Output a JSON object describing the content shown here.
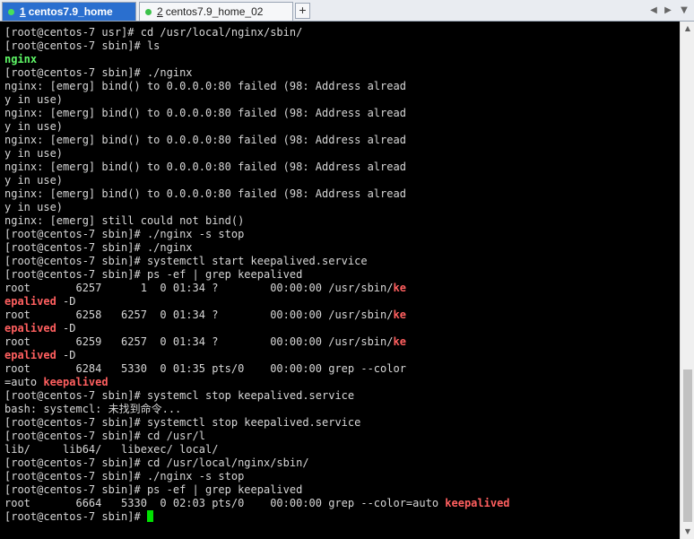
{
  "tabs": [
    {
      "number": "1",
      "label": " centos7.9_home"
    },
    {
      "number": "2",
      "label": " centos7.9_home_02"
    }
  ],
  "icons": {
    "tab_status": "green-dot-icon",
    "add_tab": "plus-icon",
    "add_tab_glyph": "+",
    "nav_left": "◀",
    "nav_right": "▶",
    "nav_menu": "▼",
    "scroll_up": "▲",
    "scroll_down": "▼"
  },
  "colors": {
    "background": "#000000",
    "text": "#d7d7d7",
    "executable": "#5ff967",
    "grep_match": "#ff5f5f",
    "cursor": "#00e000",
    "active_tab": "#2a6fcf"
  },
  "terminal": {
    "lines": [
      [
        {
          "t": "[root@centos-7 usr]# cd /usr/local/nginx/sbin/"
        }
      ],
      [
        {
          "t": "[root@centos-7 sbin]# ls"
        }
      ],
      [
        {
          "t": "nginx",
          "c": "green"
        }
      ],
      [
        {
          "t": "[root@centos-7 sbin]# ./nginx"
        }
      ],
      [
        {
          "t": "nginx: [emerg] bind() to 0.0.0.0:80 failed (98: Address alread"
        }
      ],
      [
        {
          "t": "y in use)"
        }
      ],
      [
        {
          "t": "nginx: [emerg] bind() to 0.0.0.0:80 failed (98: Address alread"
        }
      ],
      [
        {
          "t": "y in use)"
        }
      ],
      [
        {
          "t": "nginx: [emerg] bind() to 0.0.0.0:80 failed (98: Address alread"
        }
      ],
      [
        {
          "t": "y in use)"
        }
      ],
      [
        {
          "t": "nginx: [emerg] bind() to 0.0.0.0:80 failed (98: Address alread"
        }
      ],
      [
        {
          "t": "y in use)"
        }
      ],
      [
        {
          "t": "nginx: [emerg] bind() to 0.0.0.0:80 failed (98: Address alread"
        }
      ],
      [
        {
          "t": "y in use)"
        }
      ],
      [
        {
          "t": "nginx: [emerg] still could not bind()"
        }
      ],
      [
        {
          "t": "[root@centos-7 sbin]# ./nginx -s stop"
        }
      ],
      [
        {
          "t": "[root@centos-7 sbin]# ./nginx"
        }
      ],
      [
        {
          "t": "[root@centos-7 sbin]# systemctl start keepalived.service"
        }
      ],
      [
        {
          "t": "[root@centos-7 sbin]# ps -ef | grep keepalived"
        }
      ],
      [
        {
          "t": "root       6257      1  0 01:34 ?        00:00:00 /usr/sbin/"
        },
        {
          "t": "ke",
          "c": "red"
        }
      ],
      [
        {
          "t": "epalived",
          "c": "red"
        },
        {
          "t": " -D"
        }
      ],
      [
        {
          "t": "root       6258   6257  0 01:34 ?        00:00:00 /usr/sbin/"
        },
        {
          "t": "ke",
          "c": "red"
        }
      ],
      [
        {
          "t": "epalived",
          "c": "red"
        },
        {
          "t": " -D"
        }
      ],
      [
        {
          "t": "root       6259   6257  0 01:34 ?        00:00:00 /usr/sbin/"
        },
        {
          "t": "ke",
          "c": "red"
        }
      ],
      [
        {
          "t": "epalived",
          "c": "red"
        },
        {
          "t": " -D"
        }
      ],
      [
        {
          "t": "root       6284   5330  0 01:35 pts/0    00:00:00 grep --color"
        }
      ],
      [
        {
          "t": "=auto "
        },
        {
          "t": "keepalived",
          "c": "red"
        }
      ],
      [
        {
          "t": "[root@centos-7 sbin]# systemcl stop keepalived.service"
        }
      ],
      [
        {
          "t": "bash: systemcl: 未找到命令..."
        }
      ],
      [
        {
          "t": "[root@centos-7 sbin]# systemctl stop keepalived.service"
        }
      ],
      [
        {
          "t": "[root@centos-7 sbin]# cd /usr/l"
        }
      ],
      [
        {
          "t": "lib/     lib64/   libexec/ local/"
        }
      ],
      [
        {
          "t": "[root@centos-7 sbin]# cd /usr/local/nginx/sbin/"
        }
      ],
      [
        {
          "t": "[root@centos-7 sbin]# ./nginx -s stop"
        }
      ],
      [
        {
          "t": "[root@centos-7 sbin]# ps -ef | grep keepalived"
        }
      ],
      [
        {
          "t": "root       6664   5330  0 02:03 pts/0    00:00:00 grep --color=auto "
        },
        {
          "t": "keepalived",
          "c": "red"
        }
      ],
      [
        {
          "t": "[root@centos-7 sbin]# "
        }
      ]
    ]
  }
}
